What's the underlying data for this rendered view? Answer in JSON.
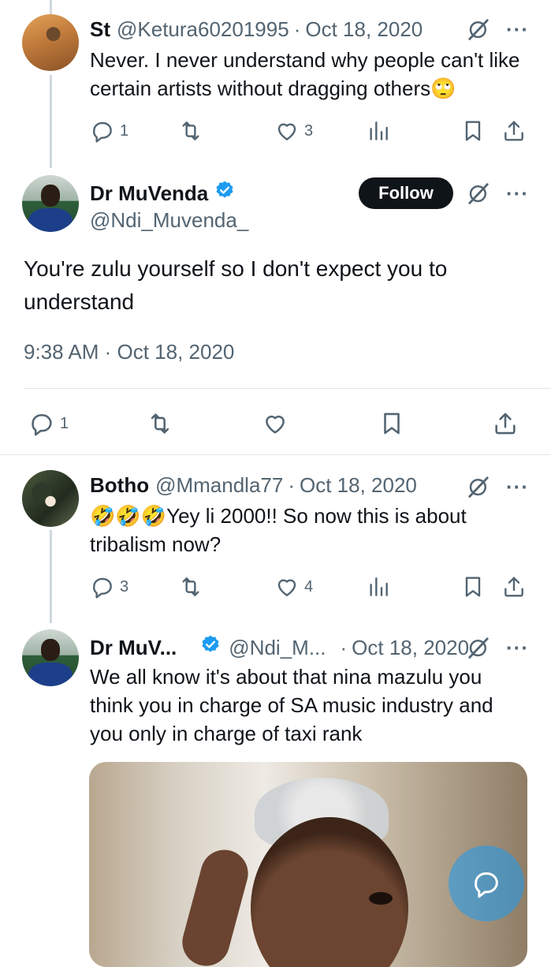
{
  "tweets": [
    {
      "name": "St",
      "handle": "@Ketura60201995",
      "separator": "·",
      "date": "Oct 18, 2020",
      "text": "Never. I never understand why people can't like certain artists without dragging others🙄",
      "replies": "1",
      "likes": "3"
    },
    {
      "name": "Dr MuVenda",
      "handle": "@Ndi_Muvenda_",
      "follow_label": "Follow",
      "text": "You're zulu yourself so I don't expect you to understand",
      "timestamp": "9:38 AM · Oct 18, 2020",
      "replies": "1"
    },
    {
      "name": "Botho",
      "handle": "@Mmandla77",
      "separator": "·",
      "date": "Oct 18, 2020",
      "text": "🤣🤣🤣Yey li 2000!! So now this is about tribalism now?",
      "replies": "3",
      "likes": "4"
    },
    {
      "name": "Dr MuV...",
      "handle": "@Ndi_M...",
      "separator": "·",
      "date": "Oct 18, 2020",
      "text": "We all know it's about that nina mazulu you think you in charge of SA music industry and you only in charge of taxi rank"
    }
  ],
  "icons": {
    "reply": "reply-icon",
    "retweet": "retweet-icon",
    "like": "heart-icon",
    "views": "views-icon",
    "bookmark": "bookmark-icon",
    "share": "share-icon",
    "grok": "grok-icon",
    "more": "more-icon",
    "verified": "verified-badge-icon",
    "compose": "reply-compose-icon"
  },
  "colors": {
    "text": "#0f1419",
    "secondary": "#536471",
    "verified": "#1d9bf0",
    "follow_bg": "#0f1419",
    "thread_line": "#cfd9de"
  }
}
